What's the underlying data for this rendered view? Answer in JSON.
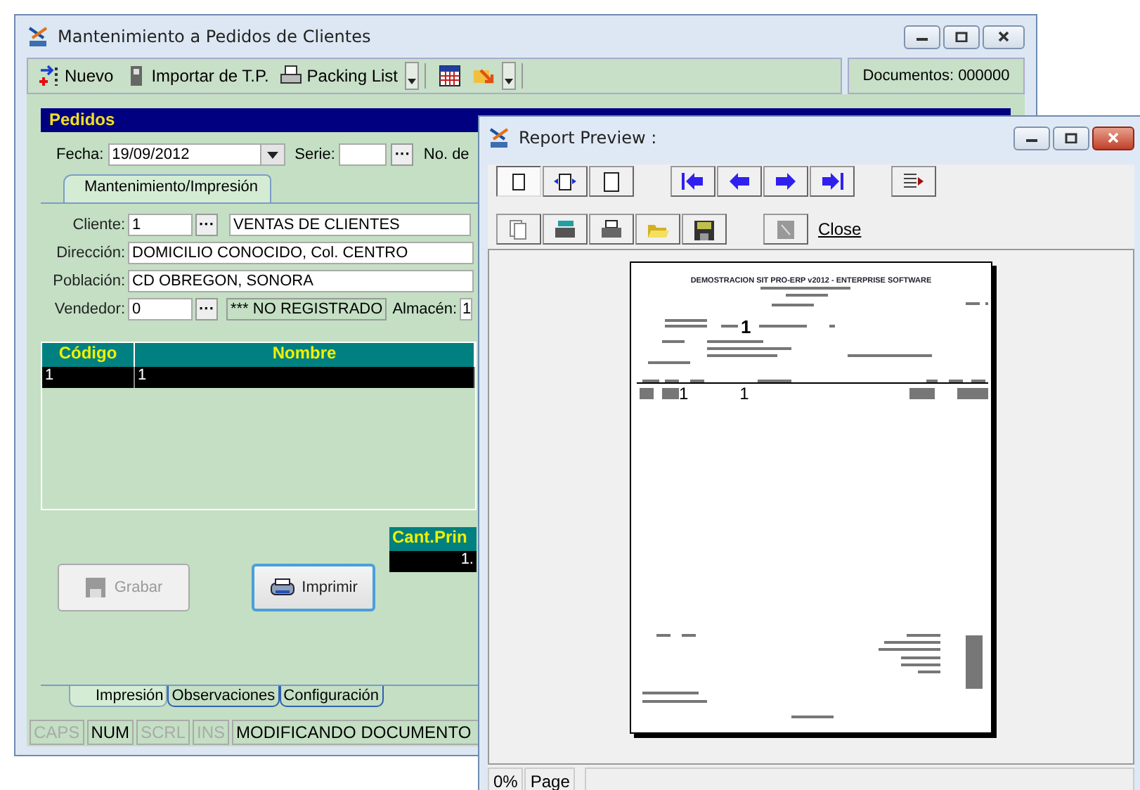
{
  "main_window": {
    "title": "Mantenimiento a Pedidos de Clientes",
    "toolbar": [
      {
        "kind": "new",
        "label": "Nuevo"
      },
      {
        "kind": "import",
        "label": "Importar de T.P."
      },
      {
        "kind": "print",
        "label": "Packing List"
      },
      {
        "kind": "dropdown"
      },
      {
        "kind": "calendar"
      },
      {
        "kind": "export"
      },
      {
        "kind": "dropdown"
      }
    ],
    "documents_counter": "Documentos: 000000",
    "section_title": "Pedidos",
    "date_label": "Fecha:",
    "date_value": "19/09/2012",
    "series_label": "Serie:",
    "lookup_label": "···",
    "number_label": "No. de",
    "top_tabs": [
      {
        "label": "Mantenimiento/Impresión",
        "selected": true
      }
    ],
    "fields": [
      {
        "label": "Cliente:",
        "value": "1",
        "kind": "lookup",
        "lookup_label": "···",
        "detail": "VENTAS DE CLIENTES"
      },
      {
        "label": "Dirección:",
        "value": "DOMICILIO CONOCIDO, Col. CENTRO",
        "kind": "text"
      },
      {
        "label": "Población:",
        "value": "CD OBREGON, SONORA",
        "kind": "text"
      },
      {
        "label": "Vendedor:",
        "value": "0",
        "kind": "lookup",
        "lookup_label": "···",
        "detail": "*** NO REGISTRADO",
        "extra_label": "Almacén:",
        "extra_value": "1"
      }
    ],
    "grid": {
      "columns": [
        "Código",
        "Nombre"
      ],
      "rows": [
        {
          "cells": [
            "1",
            "1"
          ],
          "selected": true
        }
      ]
    },
    "quantity_grid": {
      "columns": [
        "Cant.Prin"
      ],
      "rows": [
        {
          "cells": [
            "1."
          ],
          "selected": true
        }
      ]
    },
    "buttons": [
      {
        "label": "Grabar",
        "kind": "save",
        "disabled": true,
        "focused": false
      },
      {
        "label": "Imprimir",
        "kind": "print",
        "disabled": false,
        "focused": true
      }
    ],
    "bottom_tabs": [
      {
        "label": "Impresión",
        "selected": true
      },
      {
        "label": "Observaciones",
        "selected": false
      },
      {
        "label": "Configuración",
        "selected": false
      }
    ],
    "status_bar": [
      {
        "text": "CAPS",
        "on": false
      },
      {
        "text": "NUM",
        "on": true
      },
      {
        "text": "SCRL",
        "on": false
      },
      {
        "text": "INS",
        "on": false
      },
      {
        "text": "MODIFICANDO DOCUMENTO",
        "on": true
      }
    ]
  },
  "report_window": {
    "title": "Report Preview :",
    "toolbar_rows": [
      [
        {
          "kind": "one-page",
          "pressed": true
        },
        {
          "kind": "page-width",
          "pressed": false
        },
        {
          "kind": "full-page",
          "pressed": false
        },
        {
          "kind": "gap"
        },
        {
          "kind": "first",
          "pressed": false
        },
        {
          "kind": "previous",
          "pressed": false
        },
        {
          "kind": "next",
          "pressed": false
        },
        {
          "kind": "last",
          "pressed": false
        },
        {
          "kind": "gap"
        },
        {
          "kind": "goto",
          "pressed": false
        }
      ],
      [
        {
          "kind": "copy",
          "pressed": false
        },
        {
          "kind": "print-setup",
          "pressed": false
        },
        {
          "kind": "print",
          "pressed": false
        },
        {
          "kind": "open",
          "pressed": false
        },
        {
          "kind": "save",
          "pressed": false
        },
        {
          "kind": "gap"
        },
        {
          "kind": "disabled",
          "pressed": false
        }
      ]
    ],
    "close_label": "Close",
    "report_page": {
      "heading": "DEMOSTRACION SIT PRO-ERP v2012 - ENTERPRISE SOFTWARE",
      "document_number": "1",
      "line_code": "1",
      "line_description": "1"
    },
    "status_bar": [
      "0%",
      "Page"
    ]
  }
}
